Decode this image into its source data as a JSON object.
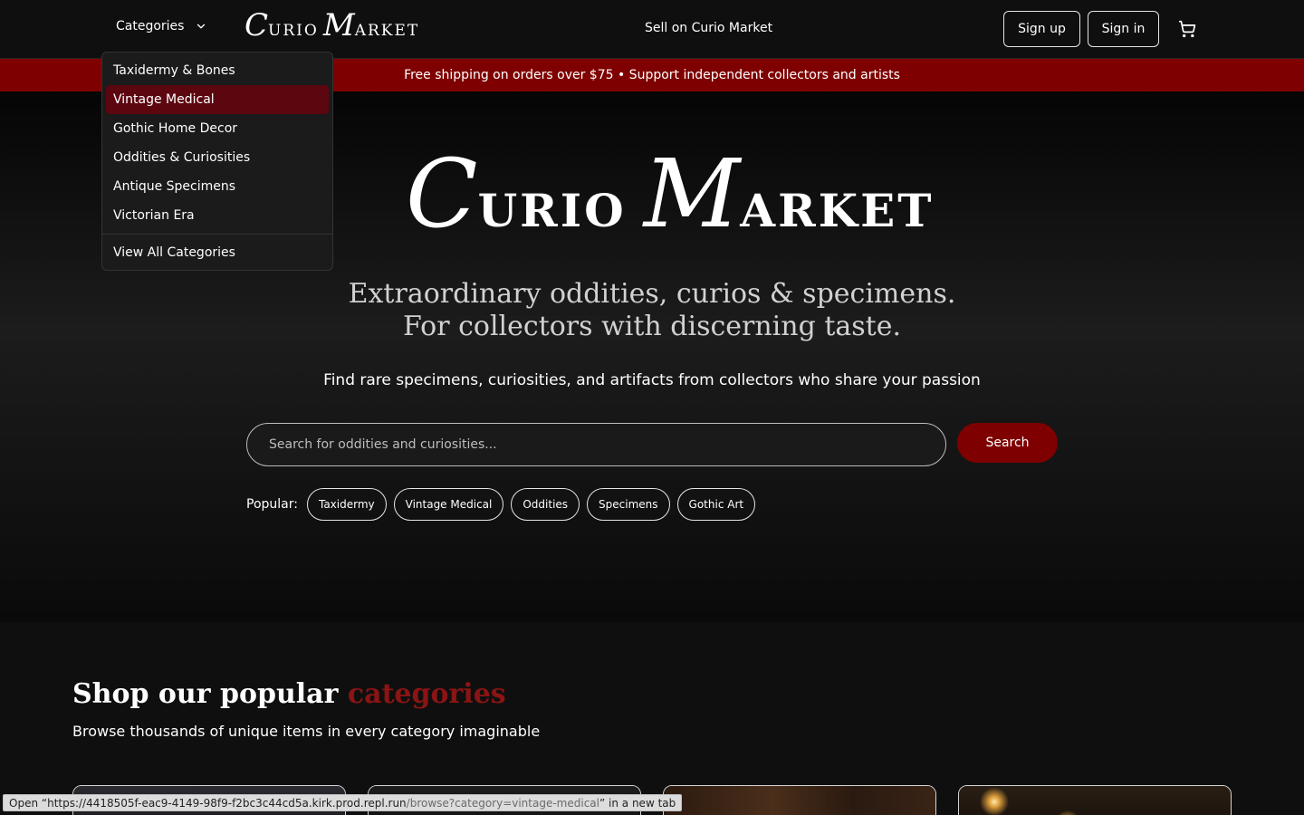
{
  "header": {
    "categories_label": "Categories",
    "logo": {
      "cap1": "C",
      "rest1": "URIO",
      "cap2": "M",
      "rest2": "ARKET"
    },
    "sell_link": "Sell on Curio Market",
    "signup": "Sign up",
    "signin": "Sign in",
    "cart_icon": "cart-icon"
  },
  "banner": {
    "text": "Free shipping on orders over $75 • Support independent collectors and artists"
  },
  "dropdown": {
    "items": [
      {
        "label": "Taxidermy & Bones",
        "active": false
      },
      {
        "label": "Vintage Medical",
        "active": true
      },
      {
        "label": "Gothic Home Decor",
        "active": false
      },
      {
        "label": "Oddities & Curiosities",
        "active": false
      },
      {
        "label": "Antique Specimens",
        "active": false
      },
      {
        "label": "Victorian Era",
        "active": false
      }
    ],
    "view_all": "View All Categories"
  },
  "hero": {
    "tagline_line1": "Extraordinary oddities, curios & specimens.",
    "tagline_line2": "For collectors with discerning taste.",
    "subtitle": "Find rare specimens, curiosities, and artifacts from collectors who share your passion",
    "search_placeholder": "Search for oddities and curiosities...",
    "search_button": "Search",
    "popular_label": "Popular:",
    "popular_tags": [
      "Taxidermy",
      "Vintage Medical",
      "Oddities",
      "Specimens",
      "Gothic Art"
    ]
  },
  "section": {
    "title_main": "Shop our popular",
    "title_accent": "categories",
    "subtitle": "Browse thousands of unique items in every category imaginable"
  },
  "status_bar": {
    "prefix": "Open “https://4418505f-eac9-4149-98f9-f2bc3c44cd5a.kirk.prod.repl.run",
    "path": "/browse?category=vintage-medical",
    "suffix": "” in a new tab"
  },
  "colors": {
    "accent": "#7f0000",
    "accent_text": "#8b1414",
    "active_item": "#5c0610",
    "header_bg": "#0f0f0f"
  }
}
